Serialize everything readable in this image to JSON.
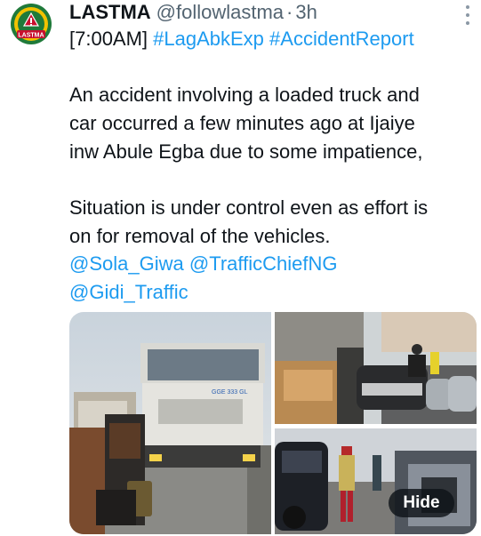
{
  "tweet": {
    "author_name": "LASTMA",
    "handle": "@followlastma",
    "separator": "·",
    "time": "3h",
    "hashtag_line_prefix": "[7:00AM] ",
    "hashtag_1": "#LagAbkExp",
    "hashtag_2": "#AccidentReport",
    "para1_line1": "An accident involving a loaded truck and",
    "para1_line2": "car occurred a few minutes ago at Ijaiye",
    "para1_line3": "inw Abule Egba due to some impatience,",
    "para2_line1": "Situation is under control even as effort is",
    "para2_line2": "on for removal of the vehicles.",
    "mention_1": "@Sola_Giwa",
    "mention_2": "@TrafficChiefNG",
    "mention_3": "@Gidi_Traffic",
    "logo_text": "LASTMA"
  },
  "media": {
    "hide_label": "Hide",
    "truck_plate": "GGE 333 GL"
  },
  "colors": {
    "link": "#1d9bf0",
    "text": "#0f1419",
    "muted": "#536471",
    "logo_green": "#1f7a3a",
    "logo_red": "#c8102e",
    "logo_yellow": "#f2c200"
  },
  "icons": {
    "more": "more-vertical-icon"
  }
}
